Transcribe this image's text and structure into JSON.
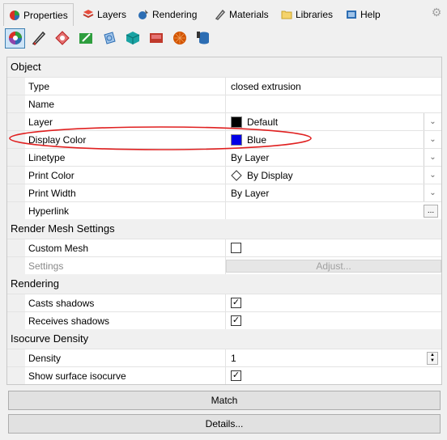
{
  "tabs": [
    {
      "label": "Properties",
      "icon": "properties-icon",
      "active": true
    },
    {
      "label": "Layers",
      "icon": "layers-icon"
    },
    {
      "label": "Rendering",
      "icon": "rendering-icon"
    },
    {
      "label": "Materials",
      "icon": "materials-icon"
    },
    {
      "label": "Libraries",
      "icon": "libraries-icon"
    },
    {
      "label": "Help",
      "icon": "help-icon"
    }
  ],
  "toolbar": [
    {
      "name": "object-properties-icon",
      "color": "#d93025",
      "active": true
    },
    {
      "name": "curve-icon",
      "color": "#555555"
    },
    {
      "name": "decal-icon",
      "color": "#c0392b"
    },
    {
      "name": "edit-geometry-icon",
      "color": "#2e9e3e"
    },
    {
      "name": "texture-mapping-icon",
      "color": "#3c7fb1"
    },
    {
      "name": "cube-icon",
      "color": "#1aa3a3"
    },
    {
      "name": "light-icon",
      "color": "#c0392b"
    },
    {
      "name": "render-mesh-icon",
      "color": "#d35400"
    },
    {
      "name": "database-icon",
      "color": "#2c6db3"
    }
  ],
  "sections": {
    "object": "Object",
    "render_mesh": "Render Mesh Settings",
    "rendering": "Rendering",
    "isocurve": "Isocurve Density"
  },
  "rows": {
    "type": {
      "label": "Type",
      "value": "closed extrusion"
    },
    "name": {
      "label": "Name",
      "value": ""
    },
    "layer": {
      "label": "Layer",
      "value": "Default",
      "swatch": "#000000"
    },
    "display_color": {
      "label": "Display Color",
      "value": "Blue",
      "swatch": "#0000e6"
    },
    "linetype": {
      "label": "Linetype",
      "value": "By Layer"
    },
    "print_color": {
      "label": "Print Color",
      "value": "By Display"
    },
    "print_width": {
      "label": "Print Width",
      "value": "By Layer"
    },
    "hyperlink": {
      "label": "Hyperlink",
      "value": "",
      "button": "..."
    },
    "custom_mesh": {
      "label": "Custom Mesh",
      "checked": false
    },
    "settings": {
      "label": "Settings",
      "button": "Adjust..."
    },
    "casts_shadows": {
      "label": "Casts shadows",
      "checked": true
    },
    "receives_shadows": {
      "label": "Receives shadows",
      "checked": true
    },
    "density": {
      "label": "Density",
      "value": "1"
    },
    "show_isocurve": {
      "label": "Show surface isocurve",
      "checked": true
    }
  },
  "buttons": {
    "match": "Match",
    "details": "Details..."
  },
  "annotation_color": "#e02020",
  "check_glyph": "✓",
  "dropdown_glyph": "⌄"
}
